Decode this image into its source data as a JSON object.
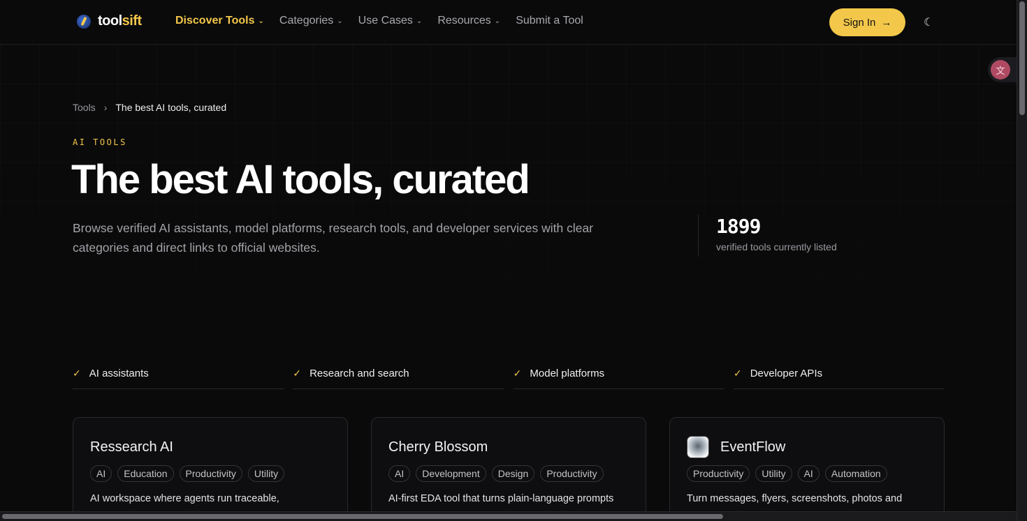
{
  "brand": {
    "tool": "tool",
    "sift": "sift"
  },
  "nav": [
    {
      "label": "Discover Tools",
      "dropdown": true,
      "active": true
    },
    {
      "label": "Categories",
      "dropdown": true
    },
    {
      "label": "Use Cases",
      "dropdown": true
    },
    {
      "label": "Resources",
      "dropdown": true
    },
    {
      "label": "Submit a Tool",
      "dropdown": false
    }
  ],
  "header": {
    "signin_label": "Sign In"
  },
  "breadcrumb": {
    "root": "Tools",
    "current": "The best AI tools, curated"
  },
  "hero": {
    "eyebrow": "AI TOOLS",
    "title": "The best AI tools, curated",
    "lead": "Browse verified AI assistants, model platforms, research tools, and developer services with clear categories and direct links to official websites."
  },
  "stat": {
    "value": "1899",
    "caption": "verified tools currently listed"
  },
  "features": [
    "AI assistants",
    "Research and search",
    "Model platforms",
    "Developer APIs"
  ],
  "cards": [
    {
      "title": "Ressearch AI",
      "has_icon": false,
      "tags": [
        "AI",
        "Education",
        "Productivity",
        "Utility"
      ],
      "desc": "AI workspace where agents run traceable,"
    },
    {
      "title": "Cherry Blossom",
      "has_icon": false,
      "tags": [
        "AI",
        "Development",
        "Design",
        "Productivity"
      ],
      "desc": "AI-first EDA tool that turns plain-language prompts"
    },
    {
      "title": "EventFlow",
      "has_icon": true,
      "tags": [
        "Productivity",
        "Utility",
        "AI",
        "Automation"
      ],
      "desc": "Turn messages, flyers, screenshots, photos and"
    }
  ],
  "colors": {
    "accent": "#f3c74a",
    "background": "#0a0a0b"
  }
}
